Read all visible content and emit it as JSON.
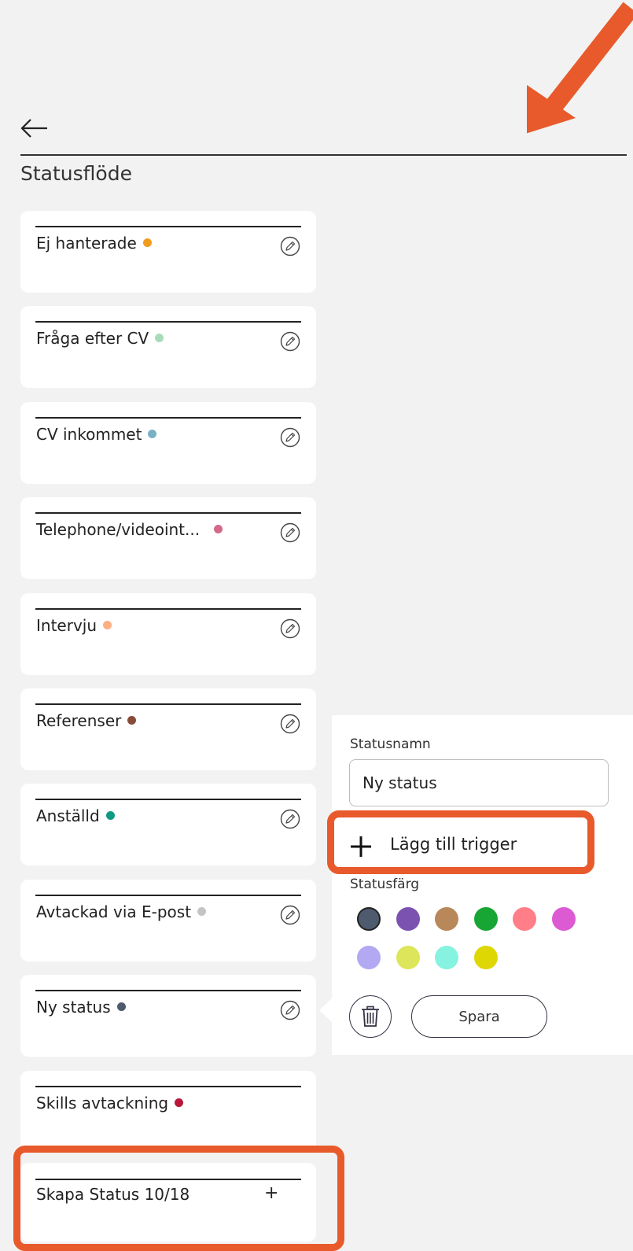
{
  "header": {
    "title": "Statusflöde"
  },
  "statuses": [
    {
      "label": "Ej hanterade",
      "color": "#f29c1f"
    },
    {
      "label": "Fråga efter CV",
      "color": "#a8dcb8"
    },
    {
      "label": "CV inkommet",
      "color": "#7ab0c4"
    },
    {
      "label": "Telephone/videoint...",
      "color": "#d26a8a"
    },
    {
      "label": "Intervju",
      "color": "#ffae82"
    },
    {
      "label": "Referenser",
      "color": "#8a4a3a"
    },
    {
      "label": "Anställd",
      "color": "#0f9a84"
    },
    {
      "label": "Avtackad via E-post",
      "color": "#c4c4c4"
    },
    {
      "label": "Ny status",
      "color": "#4e5a6e"
    },
    {
      "label": "Skills avtackning",
      "color": "#b8163a"
    }
  ],
  "create": {
    "label": "Skapa Status 10/18",
    "plus": "+"
  },
  "editor": {
    "name_label": "Statusnamn",
    "name_value": "Ny status",
    "add_trigger_label": "Lägg till trigger",
    "color_label": "Statusfärg",
    "save_label": "Spara",
    "swatches": [
      "#4e5a6e",
      "#7b52b0",
      "#b8875a",
      "#17a534",
      "#ff7e87",
      "#dc5ad2",
      "#b2a9f2",
      "#dde65a",
      "#86f2e0",
      "#dfd704"
    ],
    "selected_swatch": 0
  },
  "annotations": {
    "highlight_color": "#e85a2b"
  }
}
